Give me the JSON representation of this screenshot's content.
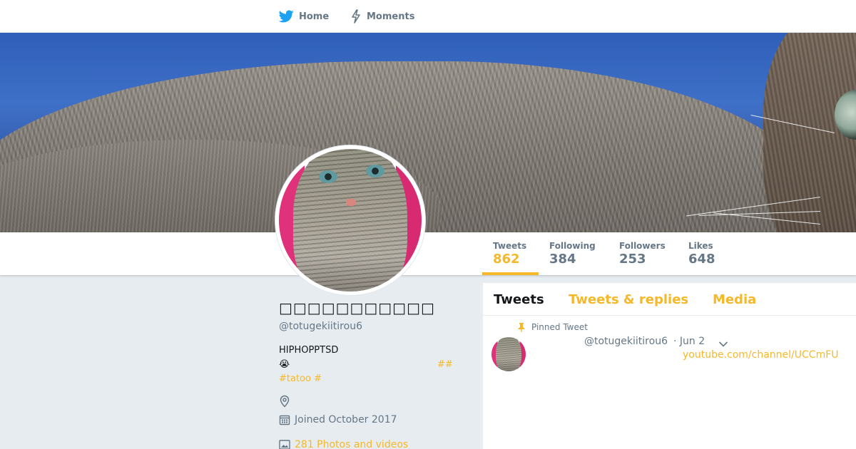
{
  "nav": {
    "home_label": "Home",
    "moments_label": "Moments"
  },
  "profile": {
    "fullname": "□□□□□□□□□□□",
    "screen_name": "@totugekiitirou6",
    "bio_line1": "HIPHOPPTSD",
    "bio_emoji": "😭",
    "bio_hash_right": "##",
    "bio_hash_link": "#tatoo #",
    "joined": "Joined October 2017",
    "photos_videos": "281 Photos and videos"
  },
  "stats": {
    "tweets_label": "Tweets",
    "tweets_value": "862",
    "following_label": "Following",
    "following_value": "384",
    "followers_label": "Followers",
    "followers_value": "253",
    "likes_label": "Likes",
    "likes_value": "648"
  },
  "timeline": {
    "tabs": [
      "Tweets",
      "Tweets & replies",
      "Media"
    ],
    "pinned_label": "Pinned Tweet",
    "tweet_handle": "@totugekiitirou6",
    "tweet_date": "· Jun 2",
    "tweet_link": "youtube.com/channel/UCCmFU"
  },
  "colors": {
    "accent": "#f5b829",
    "twitter_blue": "#1da1f2",
    "muted": "#657786"
  }
}
